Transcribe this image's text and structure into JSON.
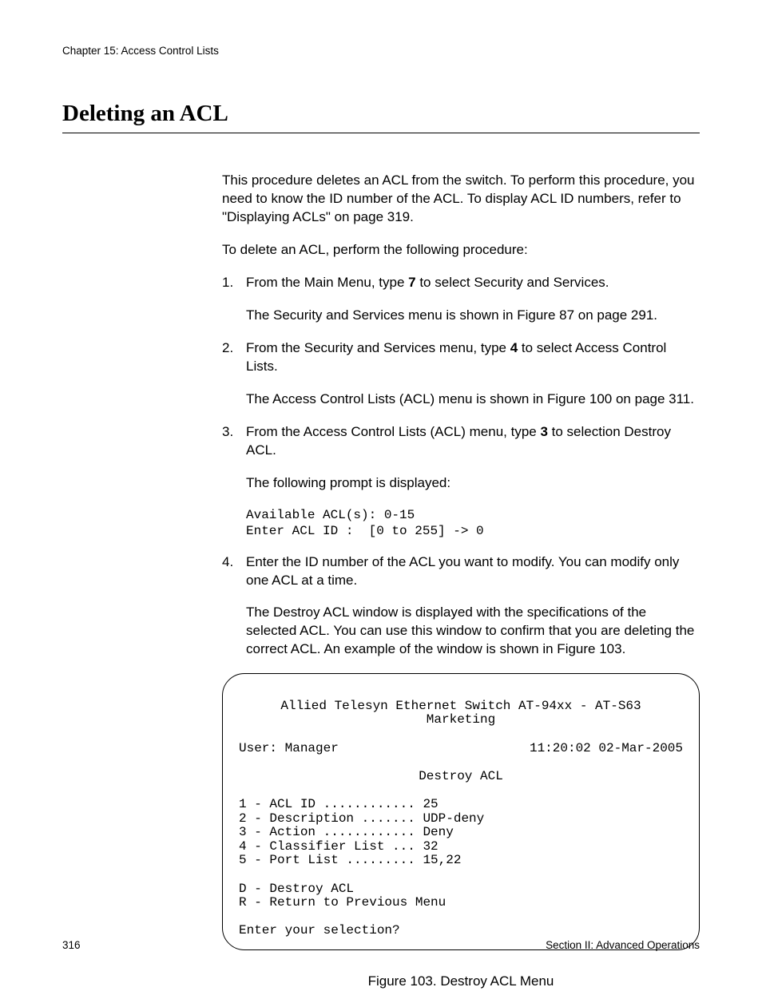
{
  "header": "Chapter 15: Access Control Lists",
  "title": "Deleting an ACL",
  "intro1": "This procedure deletes an ACL from the switch. To perform this procedure, you need to know the ID number of the ACL. To display ACL ID numbers, refer to \"Displaying ACLs\" on page 319.",
  "intro2": "To delete an ACL, perform the following procedure:",
  "steps": {
    "s1": {
      "num": "1.",
      "line_a": "From the Main Menu, type ",
      "line_b": "7",
      "line_c": " to select Security and Services.",
      "result": "The Security and Services menu is shown in Figure 87 on page 291."
    },
    "s2": {
      "num": "2.",
      "line_a": "From the Security and Services menu, type ",
      "line_b": "4",
      "line_c": " to select Access Control Lists.",
      "result": "The Access Control Lists (ACL) menu is shown in Figure 100 on page 311."
    },
    "s3": {
      "num": "3.",
      "line_a": "From the Access Control Lists (ACL) menu, type ",
      "line_b": "3",
      "line_c": " to selection Destroy ACL.",
      "prompt_label": "The following prompt is displayed:",
      "prompt_code": "Available ACL(s): 0-15\nEnter ACL ID :  [0 to 255] -> 0"
    },
    "s4": {
      "num": "4.",
      "line": "Enter the ID number of the ACL you want to modify. You can modify only one ACL at a time.",
      "result": "The Destroy ACL window is displayed with the specifications of the selected ACL. You can use this window to confirm that you are deleting the correct ACL. An example of the window is shown in Figure 103."
    }
  },
  "terminal": {
    "title": "Allied Telesyn Ethernet Switch AT-94xx - AT-S63",
    "subtitle": "Marketing",
    "user": "User: Manager",
    "timestamp": "11:20:02 02-Mar-2005",
    "menu_title": "Destroy ACL",
    "items": "1 - ACL ID ............ 25\n2 - Description ....... UDP-deny\n3 - Action ............ Deny\n4 - Classifier List ... 32\n5 - Port List ......... 15,22",
    "actions": "D - Destroy ACL\nR - Return to Previous Menu",
    "prompt": "Enter your selection?"
  },
  "caption": "Figure 103. Destroy ACL Menu",
  "footer": {
    "page": "316",
    "section": "Section II: Advanced Operations"
  }
}
